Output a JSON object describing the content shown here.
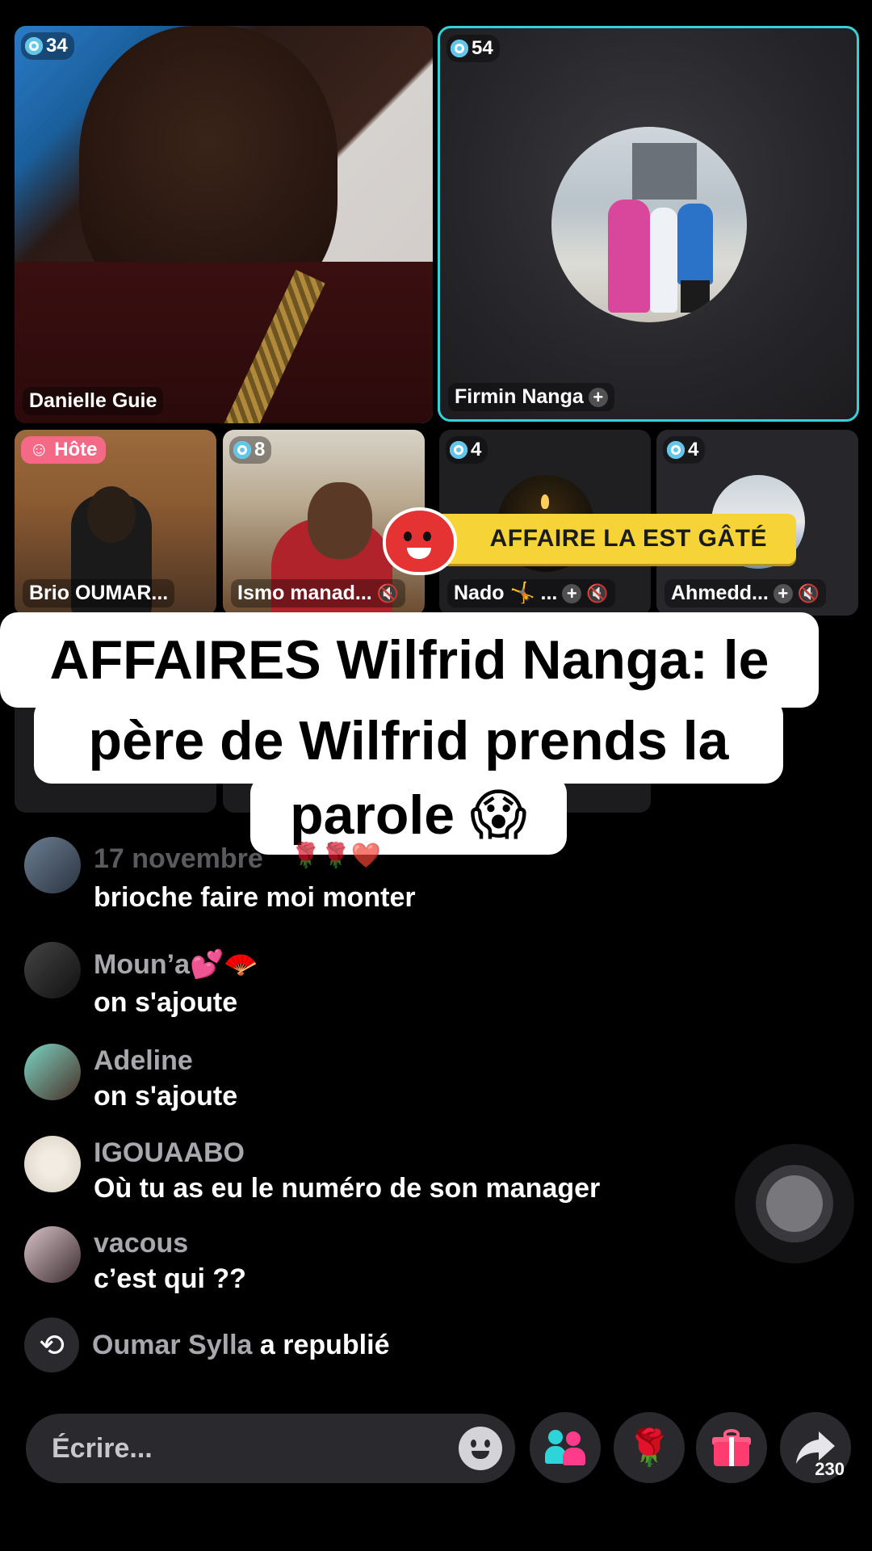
{
  "tiles": {
    "top_left": {
      "count": "34",
      "name": "Danielle Guie"
    },
    "top_right": {
      "count": "54",
      "name": "Firmin Nanga"
    },
    "small": [
      {
        "badge": "Hôte",
        "name": "Brio OUMAR..."
      },
      {
        "count": "8",
        "name": "Ismo manad..."
      },
      {
        "count": "4",
        "name": "Nado 🤸 ..."
      },
      {
        "count": "4",
        "name": "Ahmedd..."
      }
    ]
  },
  "banner": {
    "text": "AFFAIRE LA EST GÂTÉ"
  },
  "caption": {
    "line1": "AFFAIRES Wilfrid Nanga: le",
    "line2": "père de Wilfrid prends la",
    "line3": "parole 😱"
  },
  "comments": [
    {
      "user": "17 novembre",
      "deco": "🌹🌹❤️",
      "text": "brioche faire moi monter"
    },
    {
      "user": "Moun’a💕🪭",
      "text": "on s'ajoute"
    },
    {
      "user": "Adeline",
      "text": "on s'ajoute"
    },
    {
      "user": "IGOUAABO",
      "text": "Où tu as eu le numéro de son manager"
    },
    {
      "user": "vacous",
      "text": "c’est qui ??"
    }
  ],
  "repost": {
    "user": "Oumar Sylla",
    "action": "a republié"
  },
  "bottom_bar": {
    "placeholder": "Écrire...",
    "share_count": "230",
    "icons": [
      "emoji-icon",
      "guests-icon",
      "rose-icon",
      "gift-icon",
      "share-icon"
    ]
  },
  "colors": {
    "active_border": "#35d0d8",
    "host_badge": "#f46a86",
    "banner": "#f6d437",
    "username": "#a7a7ad"
  }
}
